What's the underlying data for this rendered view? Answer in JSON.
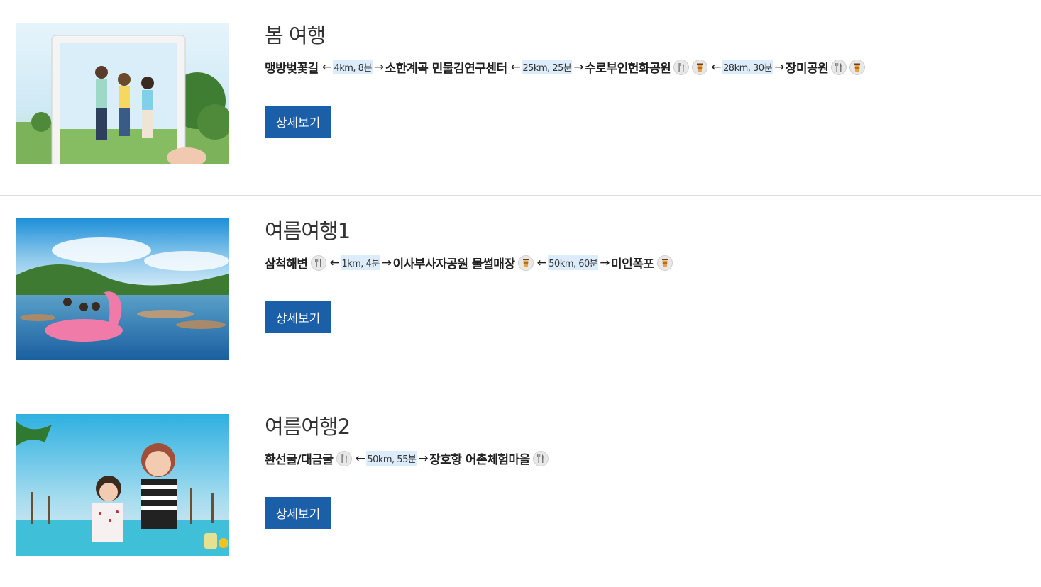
{
  "courses": [
    {
      "title": "봄 여행",
      "route": [
        {
          "kind": "place",
          "text": "맹방벚꽃길"
        },
        {
          "kind": "arrow",
          "text": "←"
        },
        {
          "kind": "dist",
          "text": "4km, 8분"
        },
        {
          "kind": "arrow",
          "text": "→"
        },
        {
          "kind": "place",
          "text": "소한계곡 민물김연구센터"
        },
        {
          "kind": "arrow",
          "text": "←"
        },
        {
          "kind": "dist",
          "text": "25km, 25분"
        },
        {
          "kind": "arrow",
          "text": "→"
        },
        {
          "kind": "place",
          "text": "수로부인헌화공원"
        },
        {
          "kind": "icon",
          "icon": "restaurant-icon"
        },
        {
          "kind": "icon",
          "icon": "cafe-icon"
        },
        {
          "kind": "arrow",
          "text": "←"
        },
        {
          "kind": "dist",
          "text": "28km, 30분"
        },
        {
          "kind": "arrow",
          "text": "→"
        },
        {
          "kind": "place",
          "text": "장미공원"
        },
        {
          "kind": "icon",
          "icon": "restaurant-icon"
        },
        {
          "kind": "icon",
          "icon": "cafe-icon"
        }
      ],
      "button": "상세보기",
      "image": "spring-travel-photo"
    },
    {
      "title": "여름여행1",
      "route": [
        {
          "kind": "place",
          "text": "삼척해변"
        },
        {
          "kind": "icon",
          "icon": "restaurant-icon"
        },
        {
          "kind": "arrow",
          "text": "←"
        },
        {
          "kind": "dist",
          "text": "1km, 4분"
        },
        {
          "kind": "arrow",
          "text": "→"
        },
        {
          "kind": "place",
          "text": "이사부사자공원 물썰매장"
        },
        {
          "kind": "icon",
          "icon": "cafe-icon"
        },
        {
          "kind": "arrow",
          "text": "←"
        },
        {
          "kind": "dist",
          "text": "50km, 60분"
        },
        {
          "kind": "arrow",
          "text": "→"
        },
        {
          "kind": "place",
          "text": "미인폭포"
        },
        {
          "kind": "icon",
          "icon": "cafe-icon"
        }
      ],
      "button": "상세보기",
      "image": "summer-river-photo"
    },
    {
      "title": "여름여행2",
      "route": [
        {
          "kind": "place",
          "text": "환선굴/대금굴"
        },
        {
          "kind": "icon",
          "icon": "restaurant-icon"
        },
        {
          "kind": "arrow",
          "text": "←"
        },
        {
          "kind": "dist",
          "text": "50km, 55분"
        },
        {
          "kind": "arrow",
          "text": "→"
        },
        {
          "kind": "place",
          "text": "장호항 어촌체험마을"
        },
        {
          "kind": "icon",
          "icon": "restaurant-icon"
        }
      ],
      "button": "상세보기",
      "image": "summer-beach-photo"
    }
  ]
}
